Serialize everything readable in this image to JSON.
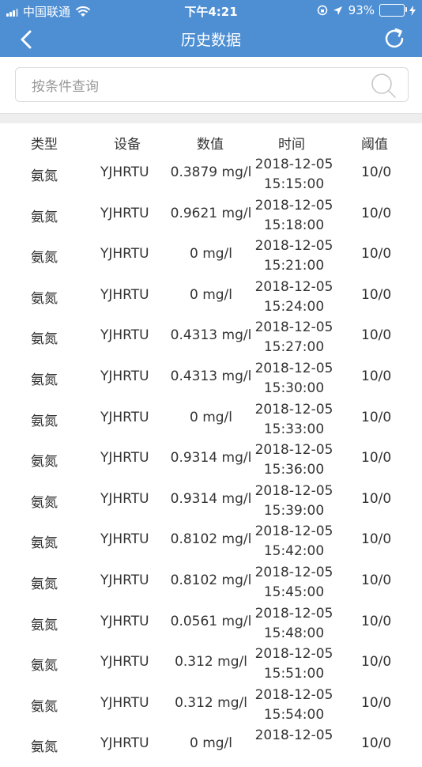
{
  "status_bar": {
    "carrier": "中国联通",
    "time": "下午4:21",
    "battery": "93%"
  },
  "nav": {
    "title": "历史数据",
    "back_icon": "back-arrow-icon",
    "refresh_icon": "refresh-icon"
  },
  "search": {
    "placeholder": "按条件查询",
    "icon": "search-icon"
  },
  "colors": {
    "header": "#4e8fd4",
    "separator": "#eeeeee",
    "text": "#333333",
    "placeholder": "#999999"
  },
  "table": {
    "headers": {
      "type": "类型",
      "device": "设备",
      "value": "数值",
      "time": "时间",
      "threshold": "阈值"
    },
    "rows": [
      {
        "type": "氨氮",
        "device": "YJHRTU",
        "value": "0.3879 mg/l",
        "date": "2018-12-05",
        "clock": "15:15:00",
        "threshold": "10/0"
      },
      {
        "type": "氨氮",
        "device": "YJHRTU",
        "value": "0.9621 mg/l",
        "date": "2018-12-05",
        "clock": "15:18:00",
        "threshold": "10/0"
      },
      {
        "type": "氨氮",
        "device": "YJHRTU",
        "value": "0 mg/l",
        "date": "2018-12-05",
        "clock": "15:21:00",
        "threshold": "10/0"
      },
      {
        "type": "氨氮",
        "device": "YJHRTU",
        "value": "0 mg/l",
        "date": "2018-12-05",
        "clock": "15:24:00",
        "threshold": "10/0"
      },
      {
        "type": "氨氮",
        "device": "YJHRTU",
        "value": "0.4313 mg/l",
        "date": "2018-12-05",
        "clock": "15:27:00",
        "threshold": "10/0"
      },
      {
        "type": "氨氮",
        "device": "YJHRTU",
        "value": "0.4313 mg/l",
        "date": "2018-12-05",
        "clock": "15:30:00",
        "threshold": "10/0"
      },
      {
        "type": "氨氮",
        "device": "YJHRTU",
        "value": "0 mg/l",
        "date": "2018-12-05",
        "clock": "15:33:00",
        "threshold": "10/0"
      },
      {
        "type": "氨氮",
        "device": "YJHRTU",
        "value": "0.9314 mg/l",
        "date": "2018-12-05",
        "clock": "15:36:00",
        "threshold": "10/0"
      },
      {
        "type": "氨氮",
        "device": "YJHRTU",
        "value": "0.9314 mg/l",
        "date": "2018-12-05",
        "clock": "15:39:00",
        "threshold": "10/0"
      },
      {
        "type": "氨氮",
        "device": "YJHRTU",
        "value": "0.8102 mg/l",
        "date": "2018-12-05",
        "clock": "15:42:00",
        "threshold": "10/0"
      },
      {
        "type": "氨氮",
        "device": "YJHRTU",
        "value": "0.8102 mg/l",
        "date": "2018-12-05",
        "clock": "15:45:00",
        "threshold": "10/0"
      },
      {
        "type": "氨氮",
        "device": "YJHRTU",
        "value": "0.0561 mg/l",
        "date": "2018-12-05",
        "clock": "15:48:00",
        "threshold": "10/0"
      },
      {
        "type": "氨氮",
        "device": "YJHRTU",
        "value": "0.312 mg/l",
        "date": "2018-12-05",
        "clock": "15:51:00",
        "threshold": "10/0"
      },
      {
        "type": "氨氮",
        "device": "YJHRTU",
        "value": "0.312 mg/l",
        "date": "2018-12-05",
        "clock": "15:54:00",
        "threshold": "10/0"
      },
      {
        "type": "氨氮",
        "device": "YJHRTU",
        "value": "0 mg/l",
        "date": "2018-12-05",
        "clock": "",
        "threshold": "10/0"
      }
    ]
  }
}
